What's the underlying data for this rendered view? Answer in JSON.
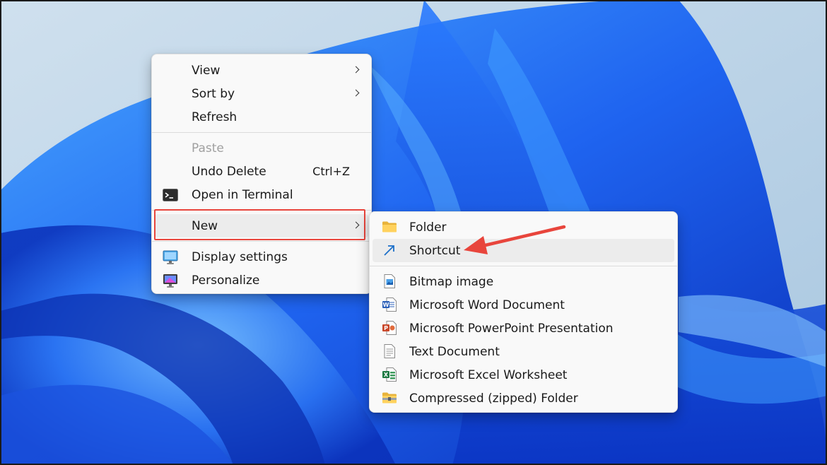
{
  "desktop": {
    "wallpaper_colors": {
      "base": "#b9d2e6",
      "deep": "#0a2fb8",
      "mid": "#1f64f0",
      "bright": "#49a7ff",
      "glow": "#7fc8ff"
    }
  },
  "context_menu": {
    "items": [
      {
        "label": "View",
        "has_submenu": true
      },
      {
        "label": "Sort by",
        "has_submenu": true
      },
      {
        "label": "Refresh"
      },
      {
        "label": "Paste",
        "disabled": true
      },
      {
        "label": "Undo Delete",
        "shortcut": "Ctrl+Z"
      },
      {
        "label": "Open in Terminal",
        "icon": "terminal-icon"
      },
      {
        "label": "New",
        "has_submenu": true,
        "highlighted": true
      },
      {
        "label": "Display settings",
        "icon": "display-settings-icon"
      },
      {
        "label": "Personalize",
        "icon": "personalize-icon"
      }
    ]
  },
  "new_submenu": {
    "items": [
      {
        "label": "Folder",
        "icon": "folder-icon"
      },
      {
        "label": "Shortcut",
        "icon": "shortcut-arrow-icon",
        "highlighted": true
      },
      {
        "label": "Bitmap image",
        "icon": "bitmap-image-icon"
      },
      {
        "label": "Microsoft Word Document",
        "icon": "word-document-icon"
      },
      {
        "label": "Microsoft PowerPoint Presentation",
        "icon": "powerpoint-icon"
      },
      {
        "label": "Text Document",
        "icon": "text-document-icon"
      },
      {
        "label": "Microsoft Excel Worksheet",
        "icon": "excel-icon"
      },
      {
        "label": "Compressed (zipped) Folder",
        "icon": "zip-folder-icon"
      }
    ]
  },
  "annotations": {
    "highlight_color": "#e8453c"
  }
}
